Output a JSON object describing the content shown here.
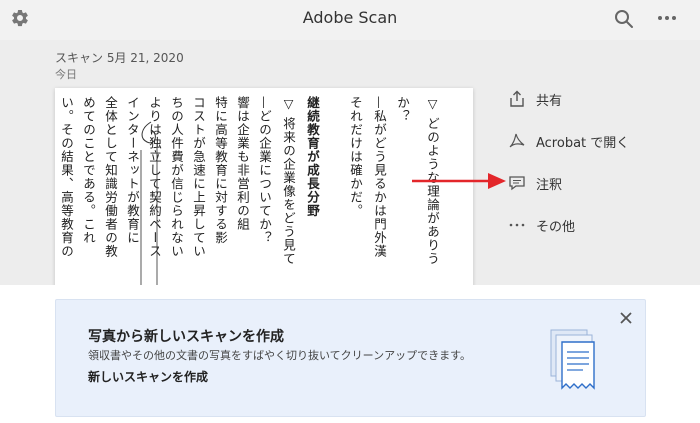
{
  "header": {
    "title": "Adobe Scan",
    "icons": {
      "settings": "gear-icon",
      "search": "search-icon",
      "more": "more-horizontal-icon"
    }
  },
  "scan": {
    "title": "スキャン 5月 21, 2020",
    "subtitle": "今日"
  },
  "document_columns": [
    "▽ どのような理論がありう",
    "か？",
    "—私がどう見るかは門外漢",
    "それだけは確かだ。",
    "継続教育が成長分野",
    "▽ 将来の企業像をどう見て",
    "—どの企業についてか？",
    "響は企業も非営利の組",
    "特に高等教育に対する影",
    "コストが急速に上昇してい",
    "ちの人件費が信じられない",
    "よりは独立して契約ベース",
    "インターネットが教育に",
    "全体として知識労働者の教",
    "めてのことである。これ",
    "い。その結果、高等教育の"
  ],
  "actions": [
    {
      "label": "共有",
      "icon": "share-icon"
    },
    {
      "label": "Acrobat で開く",
      "icon": "acrobat-icon"
    },
    {
      "label": "注釈",
      "icon": "comment-icon"
    },
    {
      "label": "その他",
      "icon": "more-icon"
    }
  ],
  "banner": {
    "title": "写真から新しいスキャンを作成",
    "description": "領収書やその他の文書の写真をすばやく切り抜いてクリーンアップできます。",
    "link": "新しいスキャンを作成",
    "icons": {
      "close": "close-icon",
      "illustration": "receipt-scan-icon"
    }
  },
  "colors": {
    "topbar": "#f2f2f2",
    "content_bg": "#ededed",
    "annotation_arrow": "#e3262a",
    "banner_bg": "#e9f0fb",
    "banner_illustration": "#2f6fc9"
  }
}
